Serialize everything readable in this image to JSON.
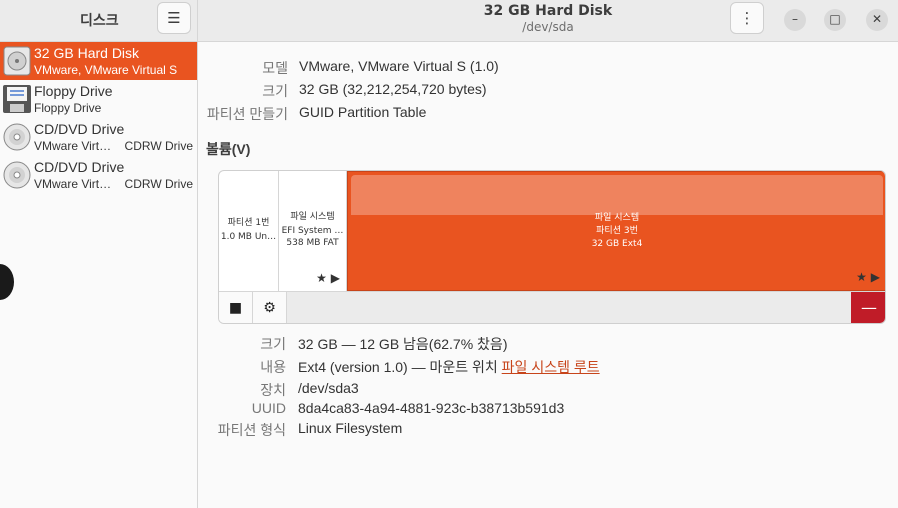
{
  "sidebar": {
    "title": "디스크",
    "menu_icon": "hamburger-menu-icon",
    "items": [
      {
        "name": "32 GB Hard Disk",
        "desc": "VMware, VMware Virtual S",
        "tag": "",
        "icon": "hard-disk-icon"
      },
      {
        "name": "Floppy Drive",
        "desc": "Floppy Drive",
        "tag": "",
        "icon": "floppy-icon"
      },
      {
        "name": "CD/DVD Drive",
        "desc": "VMware Virt…",
        "tag": "CDRW Drive",
        "icon": "optical-disc-icon"
      },
      {
        "name": "CD/DVD Drive",
        "desc": "VMware Virt…",
        "tag": "CDRW Drive",
        "icon": "optical-disc-icon"
      }
    ]
  },
  "header": {
    "title": "32 GB Hard Disk",
    "subtitle": "/dev/sda",
    "menu_glyph": "⋮",
    "minimize": "–",
    "maximize": "□",
    "close": "✕"
  },
  "disk": {
    "model_label": "모델",
    "model_value": "VMware, VMware Virtual S (1.0)",
    "size_label": "크기",
    "size_value": "32 GB (32,212,254,720 bytes)",
    "partitioning_label": "파티션 만들기",
    "partitioning_value": "GUID Partition Table"
  },
  "volumes": {
    "title": "볼륨(V)",
    "partitions": [
      {
        "line1": "파티션 1번",
        "line2": "1.0 MB Un…",
        "line3": ""
      },
      {
        "line1": "파일 시스템",
        "line2": "EFI System …",
        "line3": "538 MB FAT"
      },
      {
        "line1": "파일 시스템",
        "line2": "파티션 3번",
        "line3": "32 GB Ext4"
      }
    ],
    "toolbar": {
      "stop_glyph": "■",
      "gear_glyph": "⚙",
      "delete_glyph": "—",
      "star_glyph": "★",
      "play_glyph": "▶"
    }
  },
  "selected_volume": {
    "size_label": "크기",
    "size_value": "32 GB — 12 GB 남음(62.7% 찼음)",
    "contents_label": "내용",
    "contents_value": "Ext4 (version 1.0) — 마운트 위치 ",
    "contents_link": "파일 시스템 루트",
    "device_label": "장치",
    "device_value": "/dev/sda3",
    "uuid_label": "UUID",
    "uuid_value": "8da4ca83-4a94-4881-923c-b38713b591d3",
    "type_label": "파티션 형식",
    "type_value": "Linux Filesystem"
  }
}
